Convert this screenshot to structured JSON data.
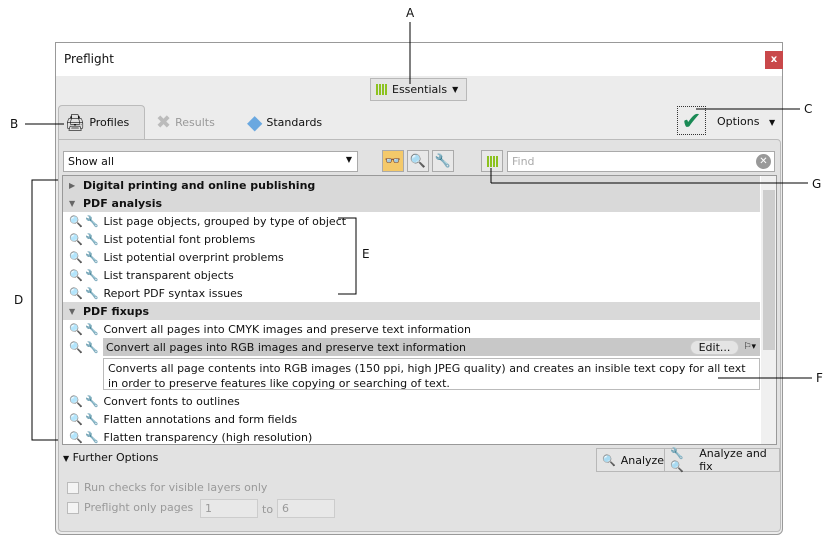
{
  "window": {
    "title": "Preflight",
    "close": "x"
  },
  "workspace": {
    "label": "Essentials"
  },
  "tabs": [
    {
      "label": "Profiles"
    },
    {
      "label": "Results"
    },
    {
      "label": "Standards"
    }
  ],
  "options": {
    "label": "Options"
  },
  "filter": {
    "value": "Show all"
  },
  "find": {
    "placeholder": "Find"
  },
  "groups": {
    "digital": "Digital printing and online publishing",
    "analysis": "PDF analysis",
    "fixups": "PDF fixups"
  },
  "analysis_items": [
    "List page objects, grouped by type of object",
    "List potential font problems",
    "List potential overprint problems",
    "List transparent objects",
    "Report PDF syntax issues"
  ],
  "fixup_items": [
    "Convert all pages into CMYK images and preserve text information",
    "Convert all pages into RGB images and preserve text information",
    "Convert fonts to outlines",
    "Flatten annotations and form fields",
    "Flatten transparency (high resolution)"
  ],
  "selected": {
    "edit": "Edit...",
    "description": "Converts all page contents into RGB images (150 ppi, high JPEG quality) and creates an insible text copy for all text in order to preserve features like copying or searching of text."
  },
  "further": {
    "label": "Further Options",
    "visible_layers": "Run checks for visible layers only",
    "only_pages": "Preflight only pages",
    "from": "1",
    "to_label": "to",
    "to": "6"
  },
  "buttons": {
    "analyze": "Analyze",
    "analyze_fix": "Analyze and fix"
  },
  "callouts": {
    "a": "A",
    "b": "B",
    "c": "C",
    "d": "D",
    "e": "E",
    "f": "F",
    "g": "G"
  }
}
